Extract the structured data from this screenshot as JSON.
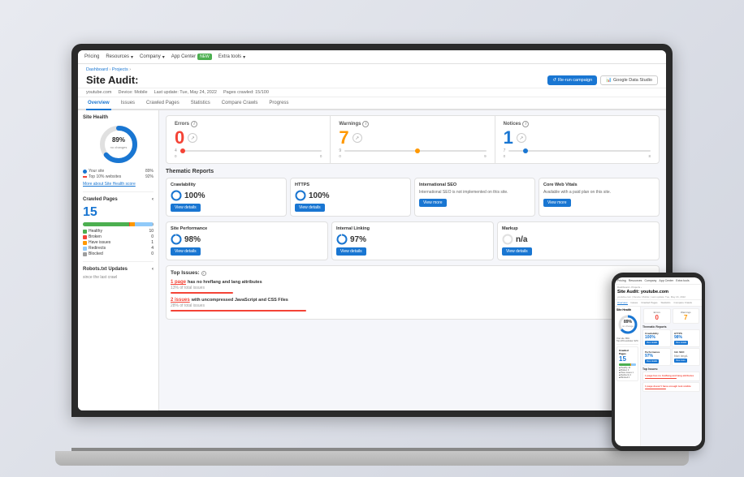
{
  "nav": {
    "items": [
      "Pricing",
      "Resources",
      "Company",
      "App Center",
      "Extra tools"
    ],
    "app_center_badge": "NEW"
  },
  "breadcrumb": {
    "items": [
      "Dashboard",
      "Projects"
    ]
  },
  "page": {
    "title": "Site Audit:",
    "domain": "youtube.com",
    "device": "Device: Mobile",
    "last_update": "Last update: Tue, May 24, 2022",
    "pages_crawled": "Pages crawled: 15/100"
  },
  "buttons": {
    "rerun": "Re-run campaign",
    "google": "Google Data Studio"
  },
  "tabs": [
    "Overview",
    "Issues",
    "Crawled Pages",
    "Statistics",
    "Compare Crawls",
    "Progress"
  ],
  "metrics": {
    "errors": {
      "label": "Errors",
      "value": "0",
      "change": "4",
      "scale_start": "0",
      "scale_end": "0"
    },
    "warnings": {
      "label": "Warnings",
      "value": "7",
      "change": "9",
      "scale_start": "0",
      "scale_end": "9"
    },
    "notices": {
      "label": "Notices",
      "value": "1",
      "change": "7",
      "scale_start": "0",
      "scale_end": "8"
    }
  },
  "site_health": {
    "label": "Site Health",
    "percentage": "89%",
    "subtitle": "no changes",
    "your_site_label": "Your site",
    "your_site_value": "89%",
    "top10_label": "Top 10% websites",
    "top10_value": "92%",
    "more_link": "More about Site Health score"
  },
  "crawled_pages": {
    "label": "Crawled Pages",
    "count": "15",
    "items": [
      {
        "label": "Healthy",
        "value": "10",
        "color": "#4CAF50"
      },
      {
        "label": "Broken",
        "value": "0",
        "color": "#f44336"
      },
      {
        "label": "Have issues",
        "value": "1",
        "color": "#FF9800"
      },
      {
        "label": "Redirects",
        "value": "4",
        "color": "#90CAF9"
      },
      {
        "label": "Blocked",
        "value": "0",
        "color": "#9E9E9E"
      }
    ]
  },
  "thematic_reports": {
    "label": "Thematic Reports",
    "cards": [
      {
        "title": "Crawlability",
        "value": "100%",
        "btn": "View details"
      },
      {
        "title": "HTTPS",
        "value": "100%",
        "btn": "View details"
      },
      {
        "title": "International SEO",
        "desc": "International SEO is not implemented on this site.",
        "btn": "View more"
      },
      {
        "title": "Core Web Vitals",
        "desc": "Available with a paid plan on this site.",
        "btn": "View more"
      },
      {
        "title": "Site Performance",
        "value": "98%",
        "btn": "View details"
      },
      {
        "title": "Internal Linking",
        "value": "97%",
        "btn": "View details"
      },
      {
        "title": "Markup",
        "value": "n/a",
        "btn": "View details"
      }
    ]
  },
  "top_issues": {
    "label": "Top Issues:",
    "items": [
      {
        "link_text": "1 page",
        "desc": "has no hreflang and lang attributes",
        "meta": "13% of total issues",
        "bar_width": "13",
        "bar_color": "#f44336"
      },
      {
        "link_text": "2 issues",
        "desc": "with uncompressed JavaScript and CSS Files",
        "meta": "28% of total issues",
        "bar_width": "28",
        "bar_color": "#f44336"
      }
    ]
  },
  "robots_section": {
    "label": "Robots.txt Updates",
    "sublabel": "since the last crawl"
  },
  "phone": {
    "domain": "Site Audit: youtube.com",
    "errors_value": "0",
    "warnings_value": "7",
    "health_pct": "89%",
    "health_subtitle": "no change",
    "crawled_num": "15",
    "issues": [
      "1 page has no hreflang and lang attributes",
      "1 page doesn't have enough text-visible"
    ]
  }
}
